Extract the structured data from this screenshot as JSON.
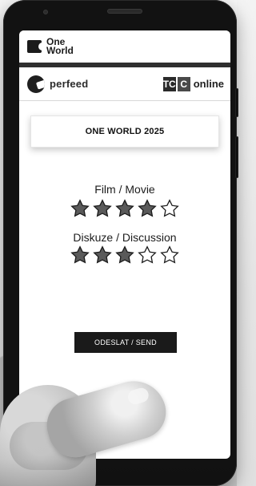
{
  "brand": {
    "oneworld_line1": "One",
    "oneworld_line2": "World",
    "perfeed_label": "perfeed",
    "tc_letters": [
      "TC",
      "C"
    ],
    "tc_online_label": "online"
  },
  "event": {
    "title": "ONE WORLD 2025"
  },
  "ratings": [
    {
      "label": "Film / Movie",
      "value": 4,
      "max": 5
    },
    {
      "label": "Diskuze / Discussion",
      "value": 3,
      "max": 5
    }
  ],
  "actions": {
    "send_label": "ODESLAT / SEND"
  },
  "colors": {
    "button_bg": "#1a1a1a",
    "star_fill": "#5a5a5a",
    "star_outline": "#1b1b1b",
    "divider": "#2f2f2f"
  },
  "icons": {
    "star": "star-icon",
    "perfeed": "perfeed-logo",
    "oneworld": "oneworld-logo",
    "tc": "tc-online-logo"
  }
}
